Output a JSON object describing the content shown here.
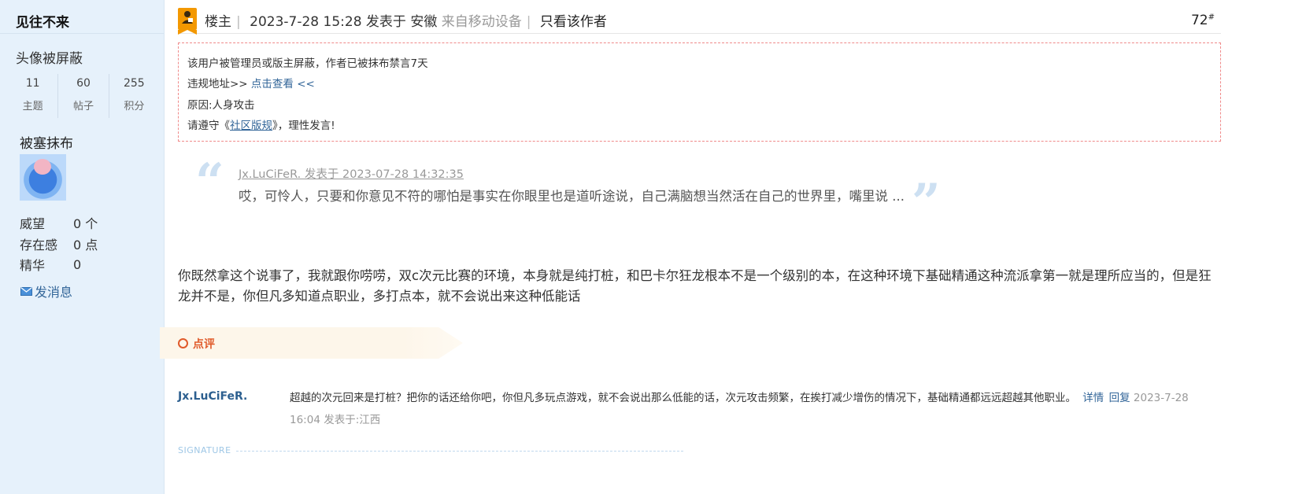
{
  "author": {
    "name": "见往不来",
    "avatar_note": "头像被屏蔽",
    "stats": [
      {
        "value": "11",
        "label": "主题"
      },
      {
        "value": "60",
        "label": "帖子"
      },
      {
        "value": "255",
        "label": "积分"
      }
    ],
    "group": "被塞抹布",
    "metrics": [
      {
        "label": "威望",
        "value": "0 个"
      },
      {
        "label": "存在感",
        "value": "0 点"
      },
      {
        "label": "精华",
        "value": "0"
      }
    ],
    "send_message": "发消息"
  },
  "header": {
    "role": "楼主",
    "datetime": "2023-7-28 15:28",
    "posted_at": "发表于 安徽",
    "device": "来自移动设备",
    "only_author": "只看该作者",
    "floor": "72",
    "floor_mark": "#"
  },
  "ban_notice": {
    "line1": "该用户被管理员或版主屏蔽，作者已被抹布禁言7天",
    "line2_prefix": "违规地址>>",
    "line2_link": " 点击查看 <<",
    "line3": "原因:人身攻击",
    "line4_prefix": "请遵守《",
    "line4_link": "社区版规",
    "line4_suffix": "》，理性发言!"
  },
  "quote": {
    "meta": "Jx.LuCiFeR. 发表于 2023-07-28 14:32:35",
    "text": "哎，可怜人，只要和你意见不符的哪怕是事实在你眼里也是道听途说，自己满脑想当然活在自己的世界里，嘴里说 ..."
  },
  "post_body": "你既然拿这个说事了，我就跟你唠唠，双c次元比赛的环境，本身就是纯打桩，和巴卡尔狂龙根本不是一个级别的本，在这种环境下基础精通这种流派拿第一就是理所应当的，但是狂龙并不是，你但凡多知道点职业，多打点本，就不会说出来这种低能话",
  "comment_section": {
    "label": "点评"
  },
  "comment": {
    "author": "Jx.LuCiFeR.",
    "text": "超越的次元回来是打桩？把你的话还给你吧，你但凡多玩点游戏，就不会说出那么低能的话，次元攻击频繁，在挨打减少增伤的情况下，基础精通都远远超越其他职业。",
    "detail": "详情",
    "reply": "回复",
    "time": "2023-7-28 16:04 发表于:江西"
  },
  "signature_label": "SIGNATURE",
  "colors": {
    "sidebar_bg": "#e6f1fb",
    "link": "#336699",
    "accent_orange": "#f39800",
    "comment_red": "#e05a2a",
    "ban_border": "#f08a8a"
  }
}
